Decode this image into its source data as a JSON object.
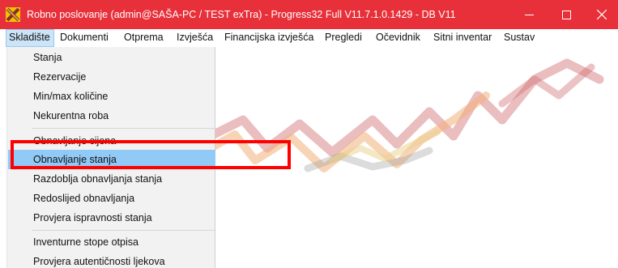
{
  "window": {
    "title": "Robno poslovanje (admin@SAŠA-PC / TEST exTra) - Progress32 Full V11.7.1.0.1429 - DB V11",
    "app_icon": "app-logo-icon",
    "titlebar_color": "#e8303a",
    "controls": {
      "minimize": "minimize-icon",
      "maximize": "maximize-icon",
      "close": "close-icon"
    }
  },
  "menubar": {
    "items": [
      {
        "label": "Skladište"
      },
      {
        "label": "Dokumenti"
      },
      {
        "label": "Otprema"
      },
      {
        "label": "Izvješća"
      },
      {
        "label": "Financijska izvješća"
      },
      {
        "label": "Pregledi"
      },
      {
        "label": "Očevidnik"
      },
      {
        "label": "Sitni inventar"
      },
      {
        "label": "Sustav"
      }
    ]
  },
  "dropdown": {
    "items": [
      {
        "label": "Stanja"
      },
      {
        "label": "Rezervacije"
      },
      {
        "label": "Min/max količine"
      },
      {
        "label": "Nekurentna roba"
      },
      {
        "label": "Obnavljanje cijena"
      },
      {
        "label": "Obnavljanje stanja"
      },
      {
        "label": "Razdoblja obnavljanja stanja"
      },
      {
        "label": "Redoslijed obnavljanja"
      },
      {
        "label": "Provjera ispravnosti stanja"
      },
      {
        "label": "Inventurne stope otpisa"
      },
      {
        "label": "Provjera autentičnosti ljekova"
      }
    ],
    "hover_color": "#91c9f7",
    "highlight_color": "#ff0000"
  }
}
